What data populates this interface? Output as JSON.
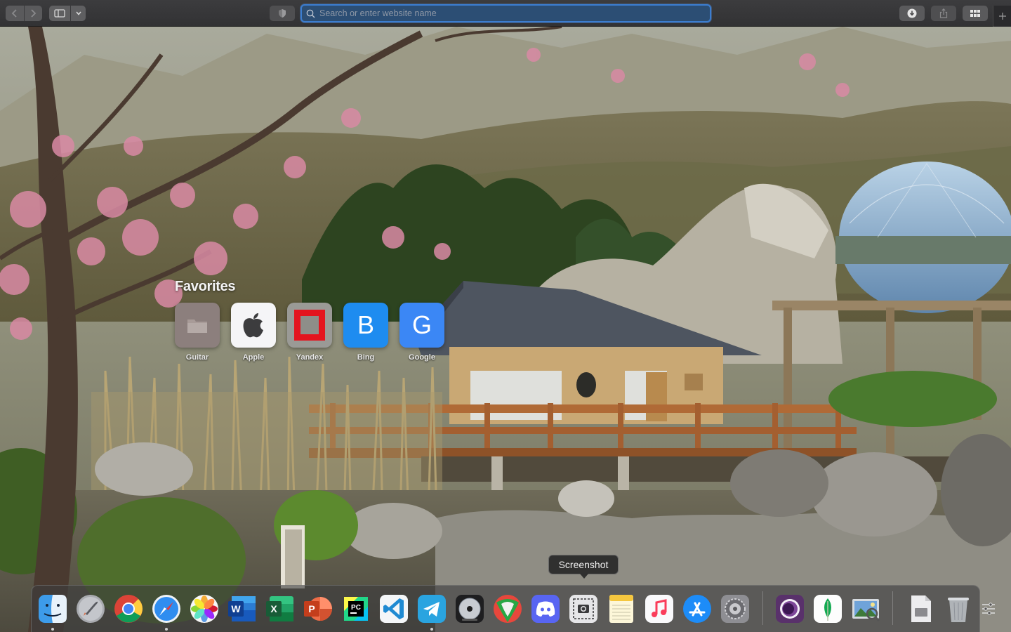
{
  "browser": {
    "address_bar": {
      "placeholder": "Search or enter website name",
      "value": ""
    },
    "toolbar_icons": [
      "back-icon",
      "forward-icon",
      "sidebar-icon",
      "chevron-down-icon",
      "shield-icon",
      "search-icon",
      "download-icon",
      "share-icon",
      "tab-overview-icon",
      "plus-icon"
    ]
  },
  "favorites": {
    "title": "Favorites",
    "items": [
      {
        "label": "Guitar",
        "icon": "folder-icon"
      },
      {
        "label": "Apple",
        "icon": "apple-logo-icon"
      },
      {
        "label": "Yandex",
        "icon": "yandex-icon"
      },
      {
        "label": "Bing",
        "glyph": "B"
      },
      {
        "label": "Google",
        "glyph": "G"
      }
    ]
  },
  "tooltip": {
    "text": "Screenshot"
  },
  "dock": {
    "apps": [
      {
        "name": "Finder",
        "running": true
      },
      {
        "name": "Launchpad",
        "running": false
      },
      {
        "name": "Chrome",
        "running": false
      },
      {
        "name": "Safari",
        "running": true
      },
      {
        "name": "Photos",
        "running": false
      },
      {
        "name": "Word",
        "running": false
      },
      {
        "name": "Excel",
        "running": false
      },
      {
        "name": "PowerPoint",
        "running": false
      },
      {
        "name": "PyCharm",
        "running": false
      },
      {
        "name": "Visual Studio Code",
        "running": false
      },
      {
        "name": "Telegram",
        "running": true
      },
      {
        "name": "DVD Player",
        "running": false
      },
      {
        "name": "Shadowrocket",
        "running": false
      },
      {
        "name": "Discord",
        "running": false
      },
      {
        "name": "Screenshot",
        "running": false
      },
      {
        "name": "Notes",
        "running": false
      },
      {
        "name": "Music",
        "running": false
      },
      {
        "name": "App Store",
        "running": false
      },
      {
        "name": "System Preferences",
        "running": false
      },
      {
        "name": "Tor Browser",
        "running": false
      },
      {
        "name": "MongoDB Compass",
        "running": false
      },
      {
        "name": "Preview",
        "running": false
      },
      {
        "name": "Downloads",
        "running": false
      },
      {
        "name": "Trash",
        "running": false
      }
    ],
    "pycharm_badge": "PC",
    "word_badge": "W",
    "excel_badge": "X",
    "powerpoint_badge": "P"
  },
  "colors": {
    "accent": "#3b7dd0",
    "toolbar": "#3a3a3c",
    "bing": "#1e8cf0",
    "google": "#3b87f5",
    "yandex_red": "#e4141e"
  }
}
